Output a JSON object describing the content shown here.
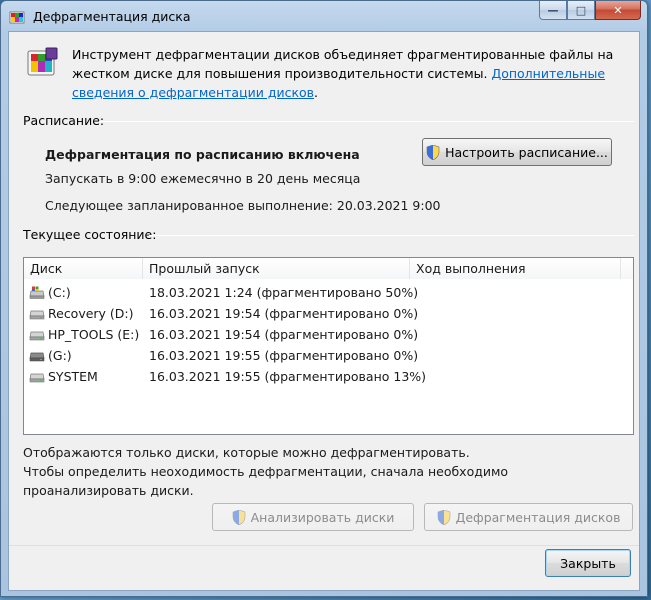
{
  "window": {
    "title": "Дефрагментация диска",
    "controls": {
      "minimize": "—",
      "maximize": "□",
      "close": "✕"
    }
  },
  "intro": {
    "text": "Инструмент дефрагментации дисков объединяет фрагментированные файлы на жестком диске для повышения производительности системы. ",
    "link": "Дополнительные сведения о дефрагментации дисков",
    "after_link": "."
  },
  "schedule": {
    "section_label": "Расписание:",
    "status": "Дефрагментация по расписанию включена",
    "run_info": "Запускать в 9:00 ежемесячно в 20 день месяца",
    "next_run": "Следующее запланированное выполнение: 20.03.2021 9:00",
    "configure_button": "Настроить расписание..."
  },
  "current_state": {
    "section_label": "Текущее состояние:",
    "columns": [
      "Диск",
      "Прошлый запуск",
      "Ход выполнения"
    ],
    "rows": [
      {
        "disk": "(C:)",
        "last_run": "18.03.2021 1:24 (фрагментировано 50%)",
        "progress": "",
        "icon": "system-drive-icon"
      },
      {
        "disk": "Recovery (D:)",
        "last_run": "16.03.2021 19:54 (фрагментировано 0%)",
        "progress": "",
        "icon": "hard-drive-icon"
      },
      {
        "disk": "HP_TOOLS (E:)",
        "last_run": "16.03.2021 19:54 (фрагментировано 0%)",
        "progress": "",
        "icon": "hard-drive-icon"
      },
      {
        "disk": "(G:)",
        "last_run": "16.03.2021 19:55 (фрагментировано 0%)",
        "progress": "",
        "icon": "removable-drive-icon"
      },
      {
        "disk": "SYSTEM",
        "last_run": "16.03.2021 19:55 (фрагментировано 13%)",
        "progress": "",
        "icon": "hard-drive-icon"
      }
    ]
  },
  "notes": {
    "line1": "Отображаются только диски, которые можно дефрагментировать.",
    "line2": "Чтобы определить неоходимость  дефрагментации, сначала необходимо проанализировать диски."
  },
  "actions": {
    "analyze_button": "Анализировать диски",
    "defrag_button": "Дефрагментация дисков",
    "close_button": "Закрыть"
  },
  "colors": {
    "link": "#0066cc",
    "close_button": "#c24a35"
  }
}
